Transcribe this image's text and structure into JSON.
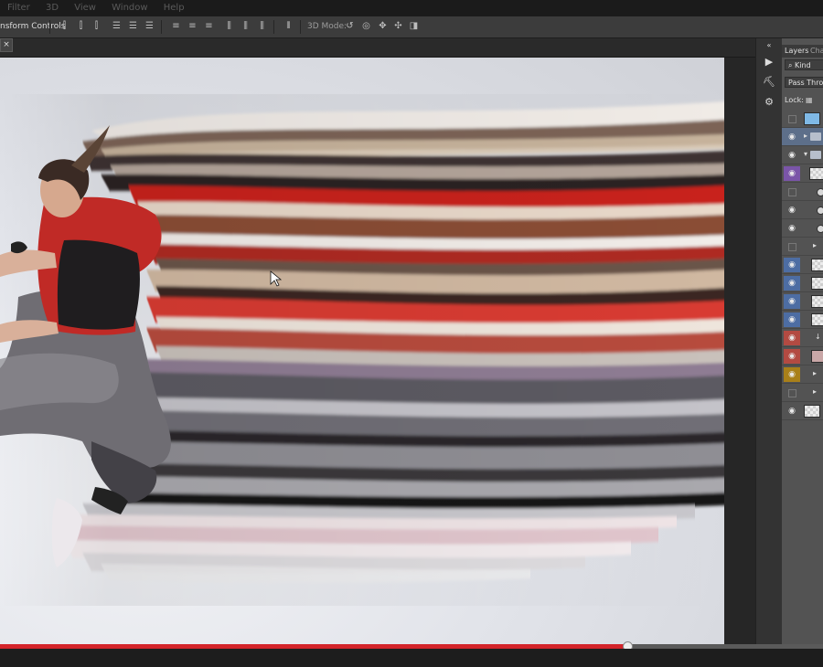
{
  "menu": [
    "Filter",
    "3D",
    "View",
    "Window",
    "Help"
  ],
  "options_bar": {
    "transform_label": "nsform Controls",
    "mode_label": "3D Mode:"
  },
  "document": {
    "close_glyph": "×"
  },
  "layers_panel": {
    "tab_layers": "Layers",
    "tab_channels": "Cha",
    "kind_filter": "Kind",
    "blend_mode": "Pass Throug",
    "lock_label": "Lock:"
  },
  "video_progress": {
    "fraction": 0.762
  },
  "colors": {
    "progress_red": "#d3242a",
    "layer_purple": "#7a55a8",
    "layer_blue": "#4d6da3",
    "layer_red": "#b34a42",
    "layer_gold": "#a98019"
  }
}
